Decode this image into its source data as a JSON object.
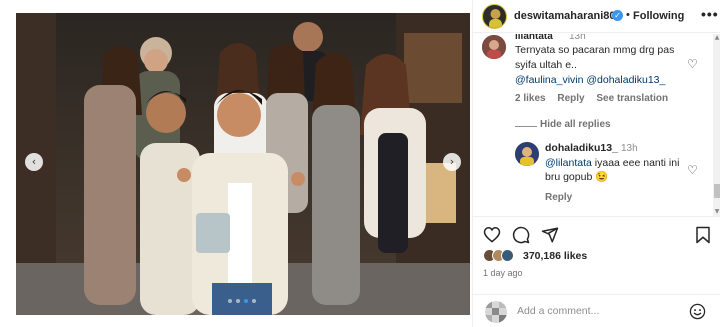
{
  "post": {
    "author": "deswitamaharani80",
    "follow_state": "Following",
    "separator": "•",
    "more": "•••",
    "carousel": {
      "prev": "‹",
      "next": "›",
      "slide_count": 4,
      "active_slide": 2
    }
  },
  "comments": {
    "top_cut_name": "lilantata",
    "top_cut_time": "13h",
    "main": {
      "line1": "Ternyata so pacaran mmg drg pas",
      "line2": "syifa ultah e..",
      "mention1": "@faulina_vivin",
      "mention2": "@dohaladiku13_",
      "likes": "2 likes",
      "reply": "Reply",
      "translate": "See translation"
    },
    "hide_replies": "Hide all replies",
    "reply": {
      "username": "dohaladiku13_",
      "time": "13h",
      "mention": "@lilantata",
      "text_line1": " iyaaa eee nanti ini",
      "text_line2": "bru gopub 😉",
      "reply_label": "Reply"
    }
  },
  "engagement": {
    "likes_count": "370,186 likes",
    "posted": "1 day ago"
  },
  "composer": {
    "placeholder": "Add a comment..."
  },
  "icons": {
    "like": "heart-icon",
    "comment": "comment-icon",
    "share": "share-icon",
    "save": "bookmark-icon",
    "emoji": "emoji-icon",
    "verified": "verified-badge-icon"
  },
  "colors": {
    "link": "#00376b",
    "verified": "#3897f0",
    "meta": "#737373"
  }
}
